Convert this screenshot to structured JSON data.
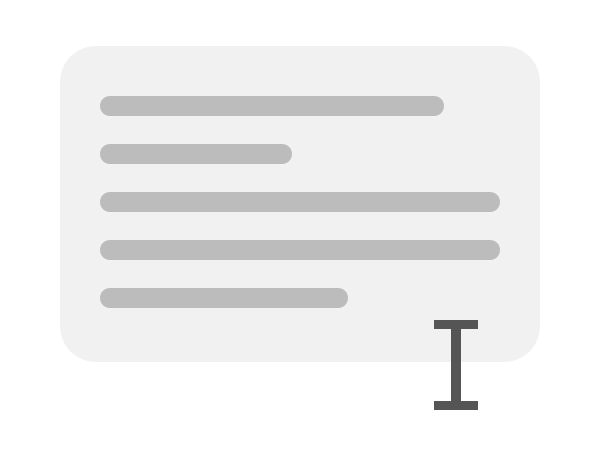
{
  "colors": {
    "background": "#ffffff",
    "card": "#f1f1f1",
    "text_line": "#bcbcbc",
    "cursor": "#555555"
  },
  "icons": {
    "cursor": "text-cursor-icon"
  }
}
